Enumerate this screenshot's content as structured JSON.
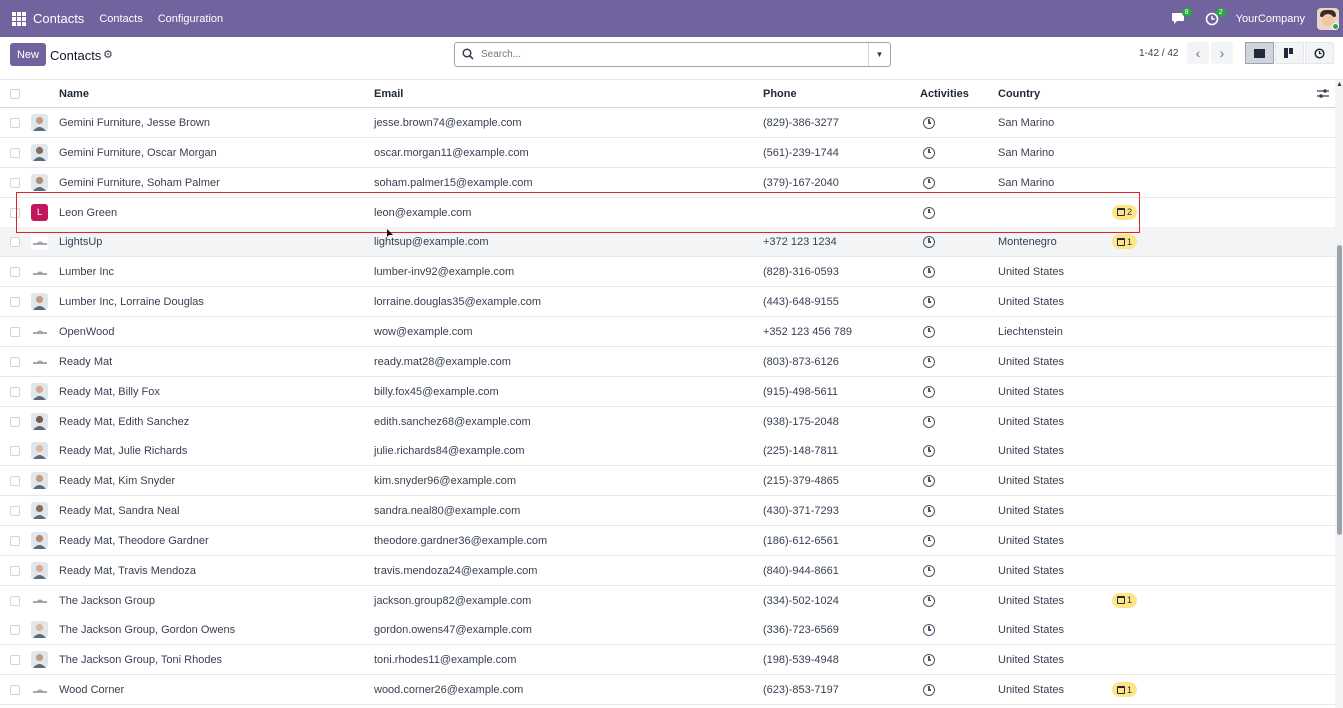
{
  "navbar": {
    "brand": "Contacts",
    "menus": [
      "Contacts",
      "Configuration"
    ],
    "messages_badge": "8",
    "activities_badge": "2",
    "company": "YourCompany",
    "color": "#71639e"
  },
  "control": {
    "new_label": "New",
    "title": "Contacts",
    "search_placeholder": "Search...",
    "pager": "1-42 / 42",
    "views": [
      "list-view-icon",
      "kanban-view-icon",
      "activity-view-icon"
    ],
    "active_view": "list"
  },
  "table": {
    "headers": {
      "name": "Name",
      "email": "Email",
      "phone": "Phone",
      "activities": "Activities",
      "country": "Country"
    },
    "rows": [
      {
        "name": "Gemini Furniture, Jesse Brown",
        "email": "jesse.brown74@example.com",
        "phone": "(829)-386-3277",
        "country": "San Marino",
        "badge": "",
        "avatar": "photo"
      },
      {
        "name": "Gemini Furniture, Oscar Morgan",
        "email": "oscar.morgan11@example.com",
        "phone": "(561)-239-1744",
        "country": "San Marino",
        "badge": "",
        "avatar": "photo"
      },
      {
        "name": "Gemini Furniture, Soham Palmer",
        "email": "soham.palmer15@example.com",
        "phone": "(379)-167-2040",
        "country": "San Marino",
        "badge": "",
        "avatar": "photo"
      },
      {
        "name": "Leon Green",
        "email": "leon@example.com",
        "phone": "",
        "country": "",
        "badge": "2",
        "avatar": "letter",
        "letter": "L"
      },
      {
        "name": "LightsUp",
        "email": "lightsup@example.com",
        "phone": "+372 123 1234",
        "country": "Montenegro",
        "badge": "1",
        "avatar": "logo"
      },
      {
        "name": "Lumber Inc",
        "email": "lumber-inv92@example.com",
        "phone": "(828)-316-0593",
        "country": "United States",
        "badge": "",
        "avatar": "logo"
      },
      {
        "name": "Lumber Inc, Lorraine Douglas",
        "email": "lorraine.douglas35@example.com",
        "phone": "(443)-648-9155",
        "country": "United States",
        "badge": "",
        "avatar": "photo"
      },
      {
        "name": "OpenWood",
        "email": "wow@example.com",
        "phone": "+352 123 456 789",
        "country": "Liechtenstein",
        "badge": "",
        "avatar": "logo"
      },
      {
        "name": "Ready Mat",
        "email": "ready.mat28@example.com",
        "phone": "(803)-873-6126",
        "country": "United States",
        "badge": "",
        "avatar": "logo"
      },
      {
        "name": "Ready Mat, Billy Fox",
        "email": "billy.fox45@example.com",
        "phone": "(915)-498-5611",
        "country": "United States",
        "badge": "",
        "avatar": "photo"
      },
      {
        "name": "Ready Mat, Edith Sanchez",
        "email": "edith.sanchez68@example.com",
        "phone": "(938)-175-2048",
        "country": "United States",
        "badge": "",
        "avatar": "photo"
      },
      {
        "name": "Ready Mat, Julie Richards",
        "email": "julie.richards84@example.com",
        "phone": "(225)-148-7811",
        "country": "United States",
        "badge": "",
        "avatar": "photo"
      },
      {
        "name": "Ready Mat, Kim Snyder",
        "email": "kim.snyder96@example.com",
        "phone": "(215)-379-4865",
        "country": "United States",
        "badge": "",
        "avatar": "photo"
      },
      {
        "name": "Ready Mat, Sandra Neal",
        "email": "sandra.neal80@example.com",
        "phone": "(430)-371-7293",
        "country": "United States",
        "badge": "",
        "avatar": "photo"
      },
      {
        "name": "Ready Mat, Theodore Gardner",
        "email": "theodore.gardner36@example.com",
        "phone": "(186)-612-6561",
        "country": "United States",
        "badge": "",
        "avatar": "photo"
      },
      {
        "name": "Ready Mat, Travis Mendoza",
        "email": "travis.mendoza24@example.com",
        "phone": "(840)-944-8661",
        "country": "United States",
        "badge": "",
        "avatar": "photo"
      },
      {
        "name": "The Jackson Group",
        "email": "jackson.group82@example.com",
        "phone": "(334)-502-1024",
        "country": "United States",
        "badge": "1",
        "avatar": "logo"
      },
      {
        "name": "The Jackson Group, Gordon Owens",
        "email": "gordon.owens47@example.com",
        "phone": "(336)-723-6569",
        "country": "United States",
        "badge": "",
        "avatar": "photo"
      },
      {
        "name": "The Jackson Group, Toni Rhodes",
        "email": "toni.rhodes11@example.com",
        "phone": "(198)-539-4948",
        "country": "United States",
        "badge": "",
        "avatar": "photo"
      },
      {
        "name": "Wood Corner",
        "email": "wood.corner26@example.com",
        "phone": "(623)-853-7197",
        "country": "United States",
        "badge": "1",
        "avatar": "logo"
      }
    ]
  }
}
